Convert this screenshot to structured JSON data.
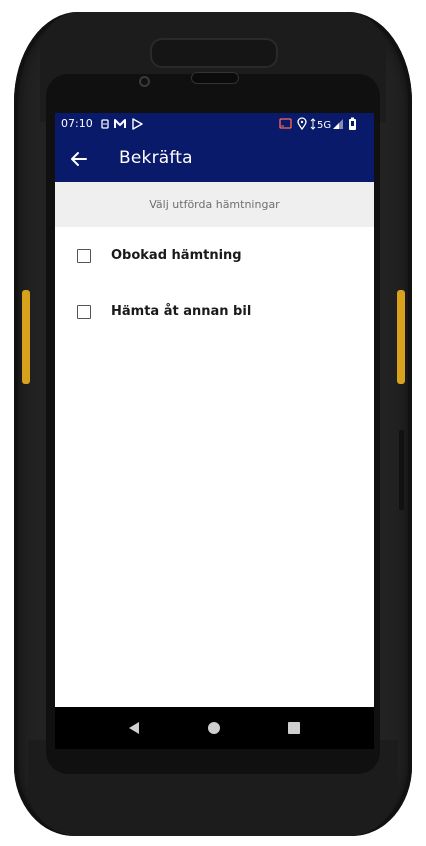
{
  "status_bar": {
    "time": "07:10",
    "network": "5G",
    "left_icons": [
      "sim-icon",
      "gmail-icon",
      "play-store-icon"
    ],
    "right_icons": [
      "cast-icon",
      "location-icon",
      "signal-icon",
      "battery-icon"
    ]
  },
  "app_bar": {
    "title": "Bekräfta",
    "back_icon": "arrow-left-icon"
  },
  "section": {
    "header": "Välj utförda hämtningar"
  },
  "options": [
    {
      "label": "Obokad hämtning",
      "checked": false
    },
    {
      "label": "Hämta åt annan bil",
      "checked": false
    }
  ],
  "nav_bar": {
    "buttons": [
      "back-triangle-icon",
      "home-circle-icon",
      "recents-square-icon"
    ]
  },
  "colors": {
    "primary": "#0a1a6b",
    "header_bg": "#efefef",
    "device_accent": "#d8a21c"
  }
}
